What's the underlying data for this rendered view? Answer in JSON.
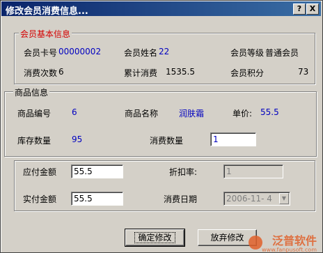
{
  "window": {
    "title": "修改会员消费信息...",
    "help_btn": "?",
    "close_btn": "X"
  },
  "member_group": {
    "legend": "会员基本信息",
    "card_no_label": "会员卡号",
    "card_no_value": "00000002",
    "name_label": "会员姓名",
    "name_value": "22",
    "level_label": "会员等级",
    "level_value": "普通会员",
    "count_label": "消费次数",
    "count_value": "6",
    "total_label": "累计消费",
    "total_value": "1535.5",
    "points_label": "会员积分",
    "points_value": "73"
  },
  "product_group": {
    "legend": "商品信息",
    "code_label": "商品编号",
    "code_value": "6",
    "name_label": "商品名称",
    "name_value": "润肤霜",
    "price_label": "单价:",
    "price_value": "55.5",
    "stock_label": "库存数量",
    "stock_value": "95",
    "qty_label": "消费数量",
    "qty_value": "1"
  },
  "payment_group": {
    "payable_label": "应付金额",
    "payable_value": "55.5",
    "discount_label": "折扣率:",
    "discount_value": "1",
    "paid_label": "实付金额",
    "paid_value": "55.5",
    "date_label": "消费日期",
    "date_value": "2006-11- 4"
  },
  "buttons": {
    "confirm": "确定修改",
    "cancel": "放弃修改"
  },
  "watermark": {
    "brand": "泛普软件",
    "url": "www.fanpusoft.com"
  }
}
